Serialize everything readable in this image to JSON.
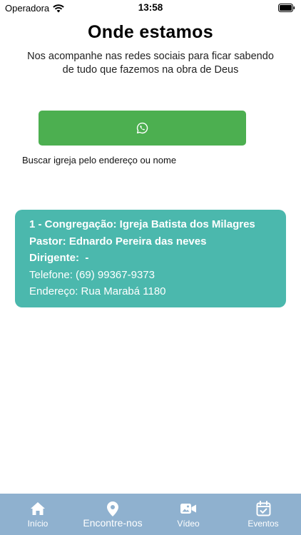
{
  "status_bar": {
    "carrier": "Operadora",
    "time": "13:58"
  },
  "page": {
    "title": "Onde estamos",
    "subtitle_line1": "Nos acompanhe nas redes sociais para ficar sabendo",
    "subtitle_line2": "de tudo que fazemos na obra de Deus"
  },
  "whatsapp_button": {
    "icon": "whatsapp-icon"
  },
  "search": {
    "label": "Buscar igreja pelo endereço ou nome"
  },
  "church_card": {
    "congregation": "1 - Congregação: Igreja Batista dos Milagres",
    "pastor": "Pastor: Ednardo Pereira das neves",
    "leader": "Dirigente:  -",
    "phone": "Telefone: (69) 99367-9373",
    "address": "Endereço: Rua Marabá 1180",
    "background_color": "#4bb8ad"
  },
  "tab_bar": {
    "background_color": "#8fb1cf",
    "tabs": [
      {
        "label": "Início",
        "icon": "home-icon"
      },
      {
        "label": "Encontre-nos",
        "icon": "map-pin-icon"
      },
      {
        "label": "Vídeo",
        "icon": "video-icon"
      },
      {
        "label": "Eventos",
        "icon": "calendar-check-icon"
      }
    ]
  }
}
